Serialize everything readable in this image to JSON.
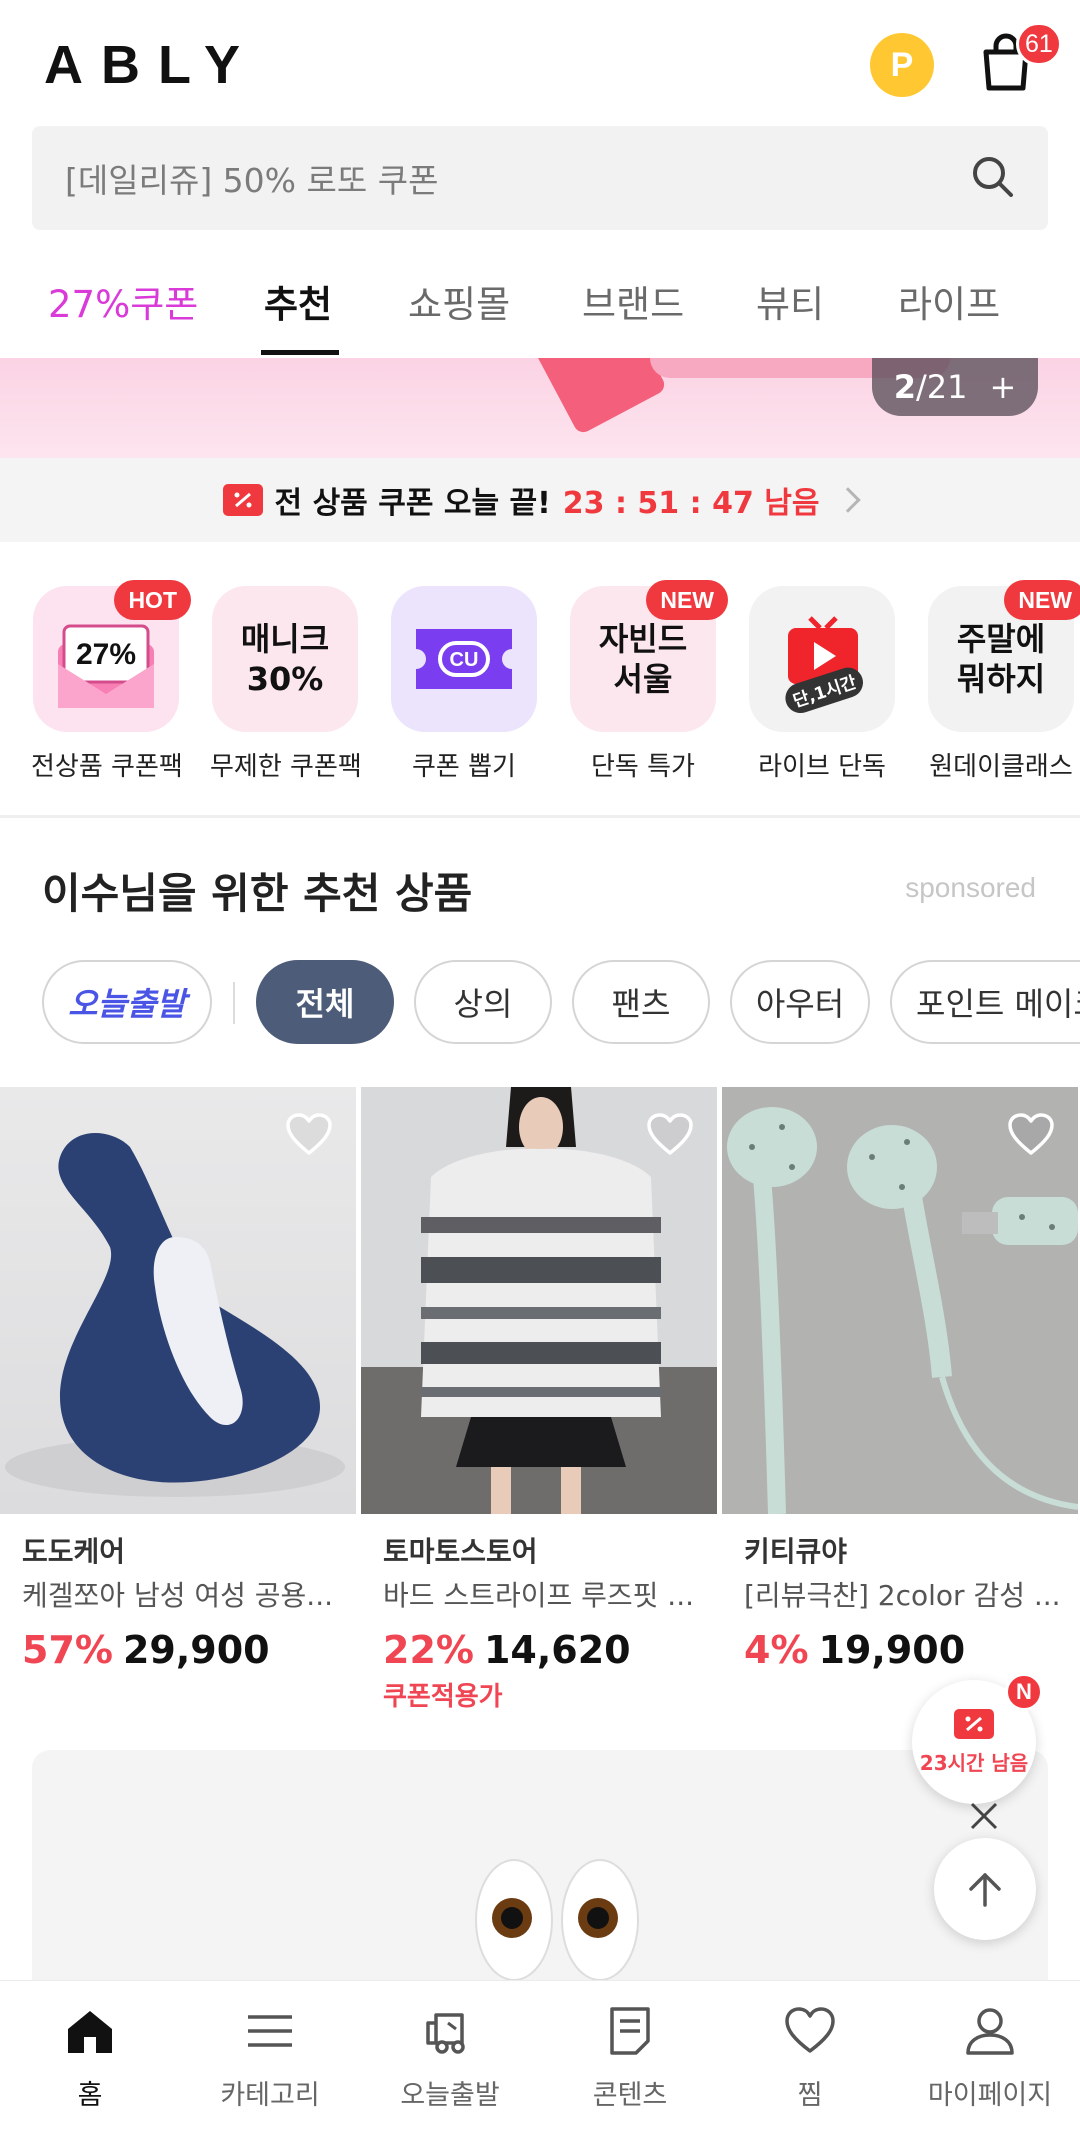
{
  "header": {
    "logo": "ABLY",
    "point_label": "P",
    "cart_count": "61"
  },
  "search": {
    "placeholder": "[데일리쥬] 50% 로또 쿠폰"
  },
  "tabs": [
    {
      "label": "27%쿠폰"
    },
    {
      "label": "추천"
    },
    {
      "label": "쇼핑몰"
    },
    {
      "label": "브랜드"
    },
    {
      "label": "뷰티"
    },
    {
      "label": "라이프"
    }
  ],
  "banner": {
    "current": "2",
    "total": "/21",
    "plus": "+"
  },
  "coupon_strip": {
    "title": "전 상품 쿠폰 오늘 끝!",
    "timer": "23 : 51 : 47 남음"
  },
  "quick_menu": [
    {
      "label": "전상품 쿠폰팩",
      "icon_text": "27%",
      "badge": "HOT"
    },
    {
      "label": "무제한 쿠폰팩",
      "icon_text": "매니크 30%",
      "badge": ""
    },
    {
      "label": "쿠폰 뽑기",
      "icon_text": "CU",
      "badge": ""
    },
    {
      "label": "단독 특가",
      "icon_text": "자빈드 서울",
      "badge": "NEW"
    },
    {
      "label": "라이브 단독",
      "icon_text": "단,1시간",
      "badge": ""
    },
    {
      "label": "원데이클래스",
      "icon_text": "주말에 뭐하지",
      "badge": "NEW"
    }
  ],
  "recommend": {
    "title": "이수님을 위한 추천 상품",
    "sponsored": "sponsored"
  },
  "chips": [
    {
      "label": "오늘출발"
    },
    {
      "label": "전체"
    },
    {
      "label": "상의"
    },
    {
      "label": "팬츠"
    },
    {
      "label": "아우터"
    },
    {
      "label": "포인트 메이크"
    }
  ],
  "products": [
    {
      "brand": "도도케어",
      "name": "케겔쪼아 남성 여성 공용...",
      "discount": "57%",
      "price": "29,900",
      "coupon": ""
    },
    {
      "brand": "토마토스토어",
      "name": "바드 스트라이프 루즈핏 ...",
      "discount": "22%",
      "price": "14,620",
      "coupon": "쿠폰적용가"
    },
    {
      "brand": "키티큐야",
      "name": "[리뷰극찬] 2color 감성 ...",
      "discount": "4%",
      "price": "19,900",
      "coupon": ""
    }
  ],
  "floating": {
    "coupon_text": "23시간 남음",
    "badge": "N"
  },
  "bottom_nav": [
    {
      "label": "홈"
    },
    {
      "label": "카테고리"
    },
    {
      "label": "오늘출발"
    },
    {
      "label": "콘텐츠"
    },
    {
      "label": "찜"
    },
    {
      "label": "마이페이지"
    }
  ],
  "colors": {
    "accent_red": "#f0393e",
    "coupon_tab": "#d93ad8",
    "chip_active": "#4d5c78",
    "point_yellow": "#ffc833"
  }
}
